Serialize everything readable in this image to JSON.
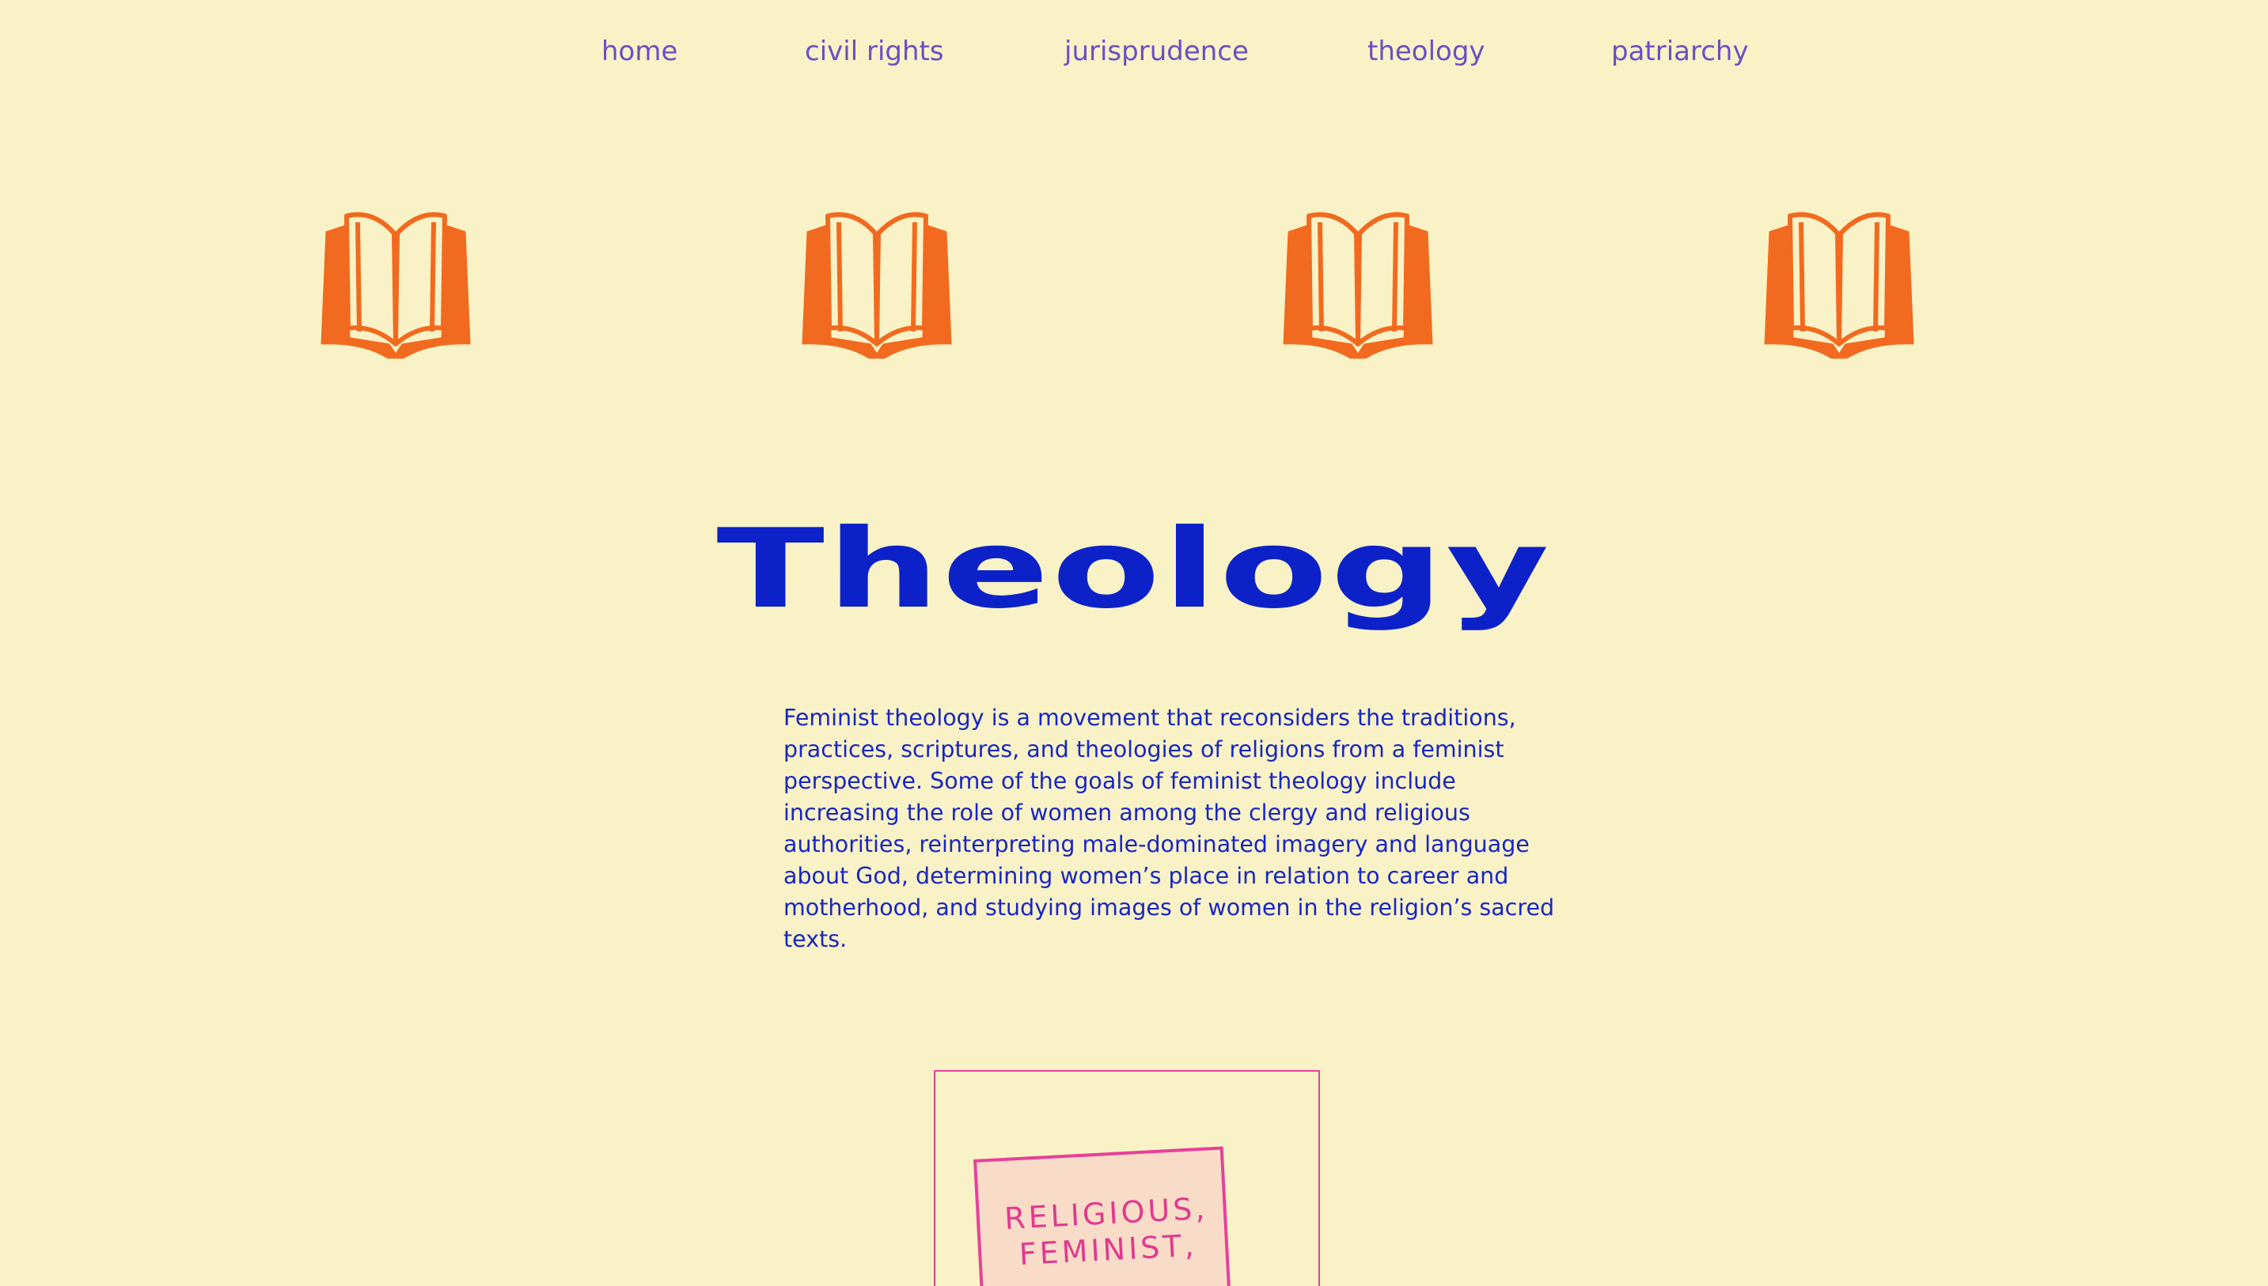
{
  "nav": {
    "items": [
      {
        "label": "home"
      },
      {
        "label": "civil rights"
      },
      {
        "label": "jurisprudence"
      },
      {
        "label": "theology"
      },
      {
        "label": "patriarchy"
      }
    ]
  },
  "icons": [
    "book-icon",
    "book-icon",
    "book-icon",
    "book-icon"
  ],
  "colors": {
    "background": "#f9f2c6",
    "nav_link": "#6a4fc4",
    "title": "#0c22c8",
    "body_text": "#1726c2",
    "book_icon": "#f26a1f",
    "stamp": "#e8409a"
  },
  "main": {
    "title": "Theology",
    "description": "Feminist theology is a movement that reconsiders the traditions, practices, scriptures, and theologies of religions from a feminist perspective. Some of the goals of feminist theology include increasing the role of women among the clergy and religious authorities, reinterpreting male-dominated imagery and language about God, determining women’s place in relation to career and motherhood, and studying images of women in the religion’s sacred texts."
  },
  "stamp": {
    "line1": "RELIGIOUS,",
    "line2": "FEMINIST,"
  }
}
